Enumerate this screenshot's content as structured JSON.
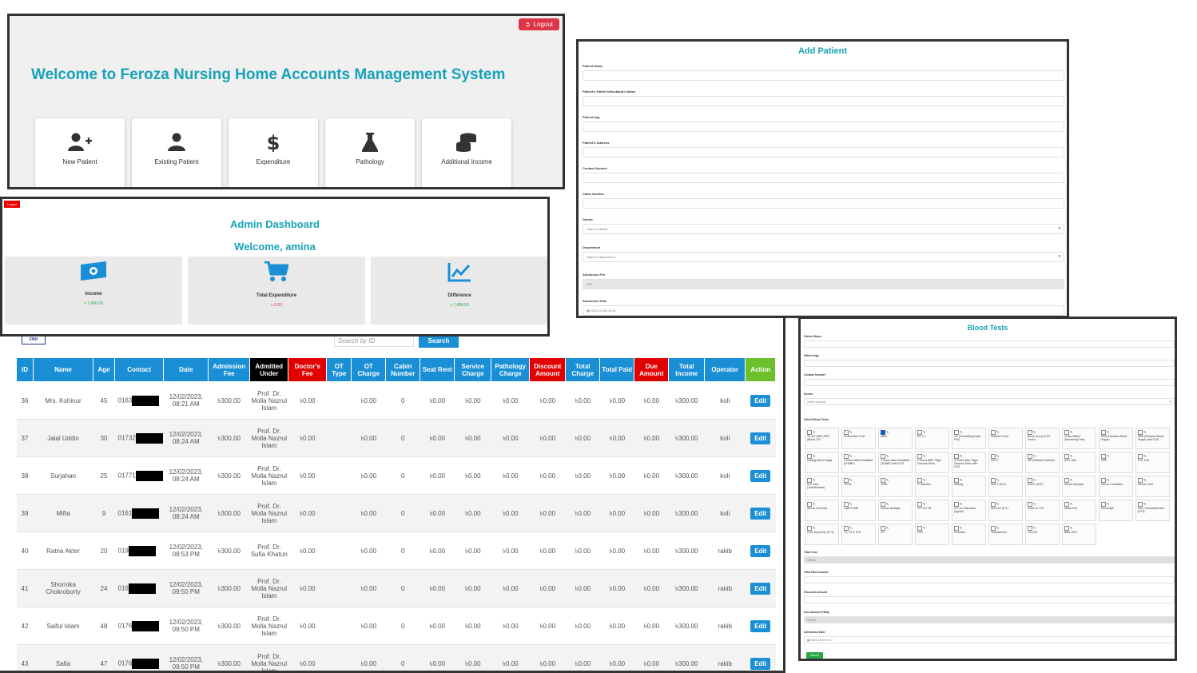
{
  "welcome": {
    "logout_label": "Logout",
    "title": "Welcome to Feroza Nursing Home Accounts Management System",
    "menu": [
      {
        "label": "New Patient",
        "icon": "user-plus-icon"
      },
      {
        "label": "Existing Patient",
        "icon": "user-icon"
      },
      {
        "label": "Expenditure",
        "icon": "dollar-icon"
      },
      {
        "label": "Pathology",
        "icon": "flask-icon"
      },
      {
        "label": "Additional Income",
        "icon": "coins-icon"
      }
    ]
  },
  "admin": {
    "logout_label": "Logout",
    "title": "Admin Dashboard",
    "welcome": "Welcome, amina",
    "stats": [
      {
        "label": "Income",
        "value": "৳ 7,400.00",
        "icon": "money-icon"
      },
      {
        "label": "Total Expenditure",
        "value": "৳ 0.00",
        "icon": "cart-icon"
      },
      {
        "label": "Difference",
        "value": "৳ 7,400.00",
        "icon": "chart-line-icon"
      }
    ]
  },
  "patients": {
    "brand": "FNH",
    "search_placeholder": "Search by ID",
    "search_label": "Search",
    "edit_label": "Edit",
    "headers": [
      "ID",
      "Name",
      "Age",
      "Contact",
      "Date",
      "Admission Fee",
      "Admitted Under",
      "Doctor's Fee",
      "OT Type",
      "OT Charge",
      "Cabin Number",
      "Seat Rent",
      "Service Charge",
      "Pathology Charge",
      "Discount Amount",
      "Total Charge",
      "Total Paid",
      "Due Amount",
      "Total Income",
      "Operator",
      "Action"
    ],
    "rows": [
      {
        "id": "36",
        "name": "Mrs. Kohinur",
        "age": "45",
        "contact": "0163",
        "date": "12/02/2023, 08:21 AM",
        "admission_fee": "৳300.00",
        "admitted_under": "Prof. Dr. Molla Nazrul Islam",
        "doctor_fee": "৳0.00",
        "ot_type": "",
        "ot_charge": "৳0.00",
        "cabin": "0",
        "seat_rent": "৳0.00",
        "service": "৳0.00",
        "pathology": "৳0.00",
        "discount": "৳0.00",
        "total_charge": "৳0.00",
        "total_paid": "৳0.00",
        "due": "৳0.00",
        "total_income": "৳300.00",
        "operator": "koli"
      },
      {
        "id": "37",
        "name": "Jalal Uddin",
        "age": "30",
        "contact": "01732",
        "date": "12/02/2023, 08:24 AM",
        "admission_fee": "৳300.00",
        "admitted_under": "Prof. Dr. Molla Nazrul Islam",
        "doctor_fee": "৳0.00",
        "ot_type": "",
        "ot_charge": "৳0.00",
        "cabin": "0",
        "seat_rent": "৳0.00",
        "service": "৳0.00",
        "pathology": "৳0.00",
        "discount": "৳0.00",
        "total_charge": "৳0.00",
        "total_paid": "৳0.00",
        "due": "৳0.00",
        "total_income": "৳300.00",
        "operator": "koli"
      },
      {
        "id": "38",
        "name": "Surjahan",
        "age": "25",
        "contact": "01771",
        "date": "12/02/2023, 08:24 AM",
        "admission_fee": "৳300.00",
        "admitted_under": "Prof. Dr. Molla Nazrul Islam",
        "doctor_fee": "৳0.00",
        "ot_type": "",
        "ot_charge": "৳0.00",
        "cabin": "0",
        "seat_rent": "৳0.00",
        "service": "৳0.00",
        "pathology": "৳0.00",
        "discount": "৳0.00",
        "total_charge": "৳0.00",
        "total_paid": "৳0.00",
        "due": "৳0.00",
        "total_income": "৳300.00",
        "operator": "koli"
      },
      {
        "id": "39",
        "name": "Mifta",
        "age": "9",
        "contact": "0161",
        "date": "12/02/2023, 08:24 AM",
        "admission_fee": "৳300.00",
        "admitted_under": "Prof. Dr. Molla Nazrul Islam",
        "doctor_fee": "৳0.00",
        "ot_type": "",
        "ot_charge": "৳0.00",
        "cabin": "0",
        "seat_rent": "৳0.00",
        "service": "৳0.00",
        "pathology": "৳0.00",
        "discount": "৳0.00",
        "total_charge": "৳0.00",
        "total_paid": "৳0.00",
        "due": "৳0.00",
        "total_income": "৳300.00",
        "operator": "koli"
      },
      {
        "id": "40",
        "name": "Ratna Akter",
        "age": "20",
        "contact": "019",
        "date": "12/02/2023, 08:53 PM",
        "admission_fee": "৳300.00",
        "admitted_under": "Prof. Dr. Sufia Khatun",
        "doctor_fee": "৳0.00",
        "ot_type": "",
        "ot_charge": "৳0.00",
        "cabin": "0",
        "seat_rent": "৳0.00",
        "service": "৳0.00",
        "pathology": "৳0.00",
        "discount": "৳0.00",
        "total_charge": "৳0.00",
        "total_paid": "৳0.00",
        "due": "৳0.00",
        "total_income": "৳300.00",
        "operator": "rakib"
      },
      {
        "id": "41",
        "name": "Shornika Chokroborty",
        "age": "24",
        "contact": "016",
        "date": "12/02/2023, 09:50 PM",
        "admission_fee": "৳300.00",
        "admitted_under": "Prof. Dr. Molla Nazrul Islam",
        "doctor_fee": "৳0.00",
        "ot_type": "",
        "ot_charge": "৳0.00",
        "cabin": "0",
        "seat_rent": "৳0.00",
        "service": "৳0.00",
        "pathology": "৳0.00",
        "discount": "৳0.00",
        "total_charge": "৳0.00",
        "total_paid": "৳0.00",
        "due": "৳0.00",
        "total_income": "৳300.00",
        "operator": "rakib"
      },
      {
        "id": "42",
        "name": "Saiful Islam",
        "age": "48",
        "contact": "0176",
        "date": "12/02/2023, 09:50 PM",
        "admission_fee": "৳300.00",
        "admitted_under": "Prof. Dr. Molla Nazrul Islam",
        "doctor_fee": "৳0.00",
        "ot_type": "",
        "ot_charge": "৳0.00",
        "cabin": "0",
        "seat_rent": "৳0.00",
        "service": "৳0.00",
        "pathology": "৳0.00",
        "discount": "৳0.00",
        "total_charge": "৳0.00",
        "total_paid": "৳0.00",
        "due": "৳0.00",
        "total_income": "৳300.00",
        "operator": "rakib"
      },
      {
        "id": "43",
        "name": "Safia",
        "age": "47",
        "contact": "0176",
        "date": "12/02/2023, 09:50 PM",
        "admission_fee": "৳300.00",
        "admitted_under": "Prof. Dr. Molla Nazrul Islam",
        "doctor_fee": "৳0.00",
        "ot_type": "",
        "ot_charge": "৳0.00",
        "cabin": "0",
        "seat_rent": "৳0.00",
        "service": "৳0.00",
        "pathology": "৳0.00",
        "discount": "৳0.00",
        "total_charge": "৳0.00",
        "total_paid": "৳0.00",
        "due": "৳0.00",
        "total_income": "৳300.00",
        "operator": "rakib"
      }
    ]
  },
  "add_patient": {
    "title": "Add Patient",
    "fields": [
      {
        "label": "Patient Name",
        "value": "",
        "kind": "text"
      },
      {
        "label": "Patient's Father's/Husband's Name",
        "value": "",
        "kind": "text"
      },
      {
        "label": "Patient Age",
        "value": "",
        "kind": "text"
      },
      {
        "label": "Patient's Address",
        "value": "",
        "kind": "text"
      },
      {
        "label": "Contact Number",
        "value": "",
        "kind": "text"
      },
      {
        "label": "Cabin Number",
        "value": "",
        "kind": "text"
      },
      {
        "label": "Doctor",
        "value": "Select a doctor",
        "kind": "select"
      },
      {
        "label": "Department",
        "value": "Select a department",
        "kind": "select"
      },
      {
        "label": "Admission Fee",
        "value": "300",
        "kind": "readonly"
      },
      {
        "label": "Admission Date",
        "value": "2023-12-06 00:14",
        "kind": "date"
      }
    ]
  },
  "blood_tests": {
    "title": "Blood Tests",
    "fields_top": [
      {
        "label": "Patient Name",
        "value": "",
        "kind": "text"
      },
      {
        "label": "Patient Age",
        "value": "",
        "kind": "text"
      },
      {
        "label": "Contact Number",
        "value": "",
        "kind": "text"
      },
      {
        "label": "Doctor",
        "value": "Select a doctor",
        "kind": "select"
      }
    ],
    "tests_label": "Select Blood Tests",
    "tests": [
      {
        "name": "TC,DC,HB%,ESR (Blood CP)",
        "checked": false
      },
      {
        "name": "Prothombin Time",
        "checked": false
      },
      {
        "name": "HB%",
        "checked": true
      },
      {
        "name": "BT, CT",
        "checked": false
      },
      {
        "name": "CE (Circulating Eosin Phil)",
        "checked": false
      },
      {
        "name": "Platelet Count",
        "checked": false
      },
      {
        "name": "Blood Group & Rh Factor",
        "checked": false
      },
      {
        "name": "Cross Match (Screening Test)",
        "checked": false
      },
      {
        "name": "RBS (Random Blood Sugar)",
        "checked": false
      },
      {
        "name": "RBS (Random Blood Sugar) with CUS",
        "checked": false
      },
      {
        "name": "Fasting Blood Sugar",
        "checked": false
      },
      {
        "name": "2 Hours After Breakfast (2HABF)",
        "checked": false
      },
      {
        "name": "2 Hours After Breakfast (2HABF) with CUS",
        "checked": false
      },
      {
        "name": "2 Hours After 75gm Glucose Drink",
        "checked": false
      },
      {
        "name": "2 Hours After 75gm Glucose Drink with CUS",
        "checked": false
      },
      {
        "name": "OGTT",
        "checked": false
      },
      {
        "name": "MP (Malaria Parasite)",
        "checked": false
      },
      {
        "name": "ASO Titre",
        "checked": false
      },
      {
        "name": "CRP",
        "checked": false
      },
      {
        "name": "R.A. Test",
        "checked": false
      },
      {
        "name": "R.A. Test (Turbidimetric)",
        "checked": false
      },
      {
        "name": "TPHA",
        "checked": false
      },
      {
        "name": "VDRL",
        "checked": false
      },
      {
        "name": "S. Bilirubin",
        "checked": false
      },
      {
        "name": "HBsAg",
        "checked": false
      },
      {
        "name": "SGPT (ALT)",
        "checked": false
      },
      {
        "name": "SGOT (AST)",
        "checked": false
      },
      {
        "name": "Serum Amylase",
        "checked": false
      },
      {
        "name": "Serum Creatinine",
        "checked": false
      },
      {
        "name": "Serum Urea",
        "checked": false
      },
      {
        "name": "Serum Uric Acid",
        "checked": false
      },
      {
        "name": "Lipid Profile",
        "checked": false
      },
      {
        "name": "Semen Analysis",
        "checked": false
      },
      {
        "name": "ICT For TB",
        "checked": false
      },
      {
        "name": "ICT for Kala-Azar (Ag/Ab)",
        "checked": false
      },
      {
        "name": "Anti HIV (ICT)",
        "checked": false
      },
      {
        "name": "Urine for C/S",
        "checked": false
      },
      {
        "name": "Widal Test",
        "checked": false
      },
      {
        "name": "Electrolyte",
        "checked": false
      },
      {
        "name": "Free Triiodothyronine (FT3)",
        "checked": false
      },
      {
        "name": "Free Thyroxine (FT4)",
        "checked": false
      },
      {
        "name": "T3, T4 & TSH",
        "checked": false
      },
      {
        "name": "LH",
        "checked": false
      },
      {
        "name": "FSH",
        "checked": false
      },
      {
        "name": "Prolactin",
        "checked": false
      },
      {
        "name": "Testosterone",
        "checked": false
      },
      {
        "name": "CA-125",
        "checked": false
      },
      {
        "name": "Beta HCG",
        "checked": false
      }
    ],
    "fields_bottom": [
      {
        "label": "Total Cost",
        "value": "150.00",
        "kind": "readonly"
      },
      {
        "label": "Total Paid Amount",
        "value": "",
        "kind": "text"
      },
      {
        "label": "Discount Amount",
        "value": "",
        "kind": "text"
      },
      {
        "label": "Due Amount (Taka)",
        "value": "150.00",
        "kind": "readonly"
      },
      {
        "label": "Admission Date",
        "value": "2023-12-05 07:17",
        "kind": "date"
      }
    ],
    "submit_label": "Submit"
  }
}
